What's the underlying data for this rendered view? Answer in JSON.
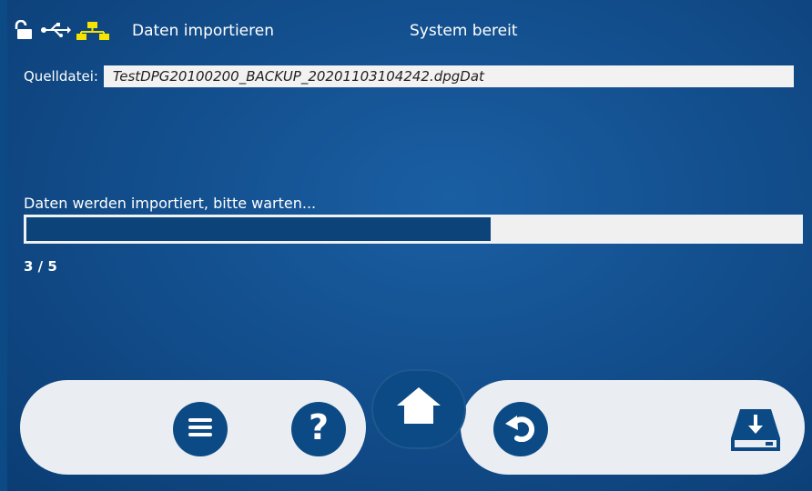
{
  "header": {
    "title": "Daten importieren",
    "status": "System bereit",
    "icons": [
      "lock-open-icon",
      "usb-icon",
      "network-icon"
    ]
  },
  "source": {
    "label": "Quelldatei:",
    "value": "TestDPG20100200_BACKUP_20201103104242.dpgDat"
  },
  "progress": {
    "message": "Daten werden importiert, bitte warten...",
    "fraction": 0.6,
    "step": "3 / 5"
  },
  "dock": {
    "buttons": [
      "menu-icon",
      "help-icon",
      "home-icon",
      "back-icon",
      "import-drive-icon"
    ]
  },
  "colors": {
    "background": "#134f8e",
    "bar_fill": "#0c4379",
    "accent_yellow": "#f5e400",
    "pill": "#eaeef2"
  }
}
